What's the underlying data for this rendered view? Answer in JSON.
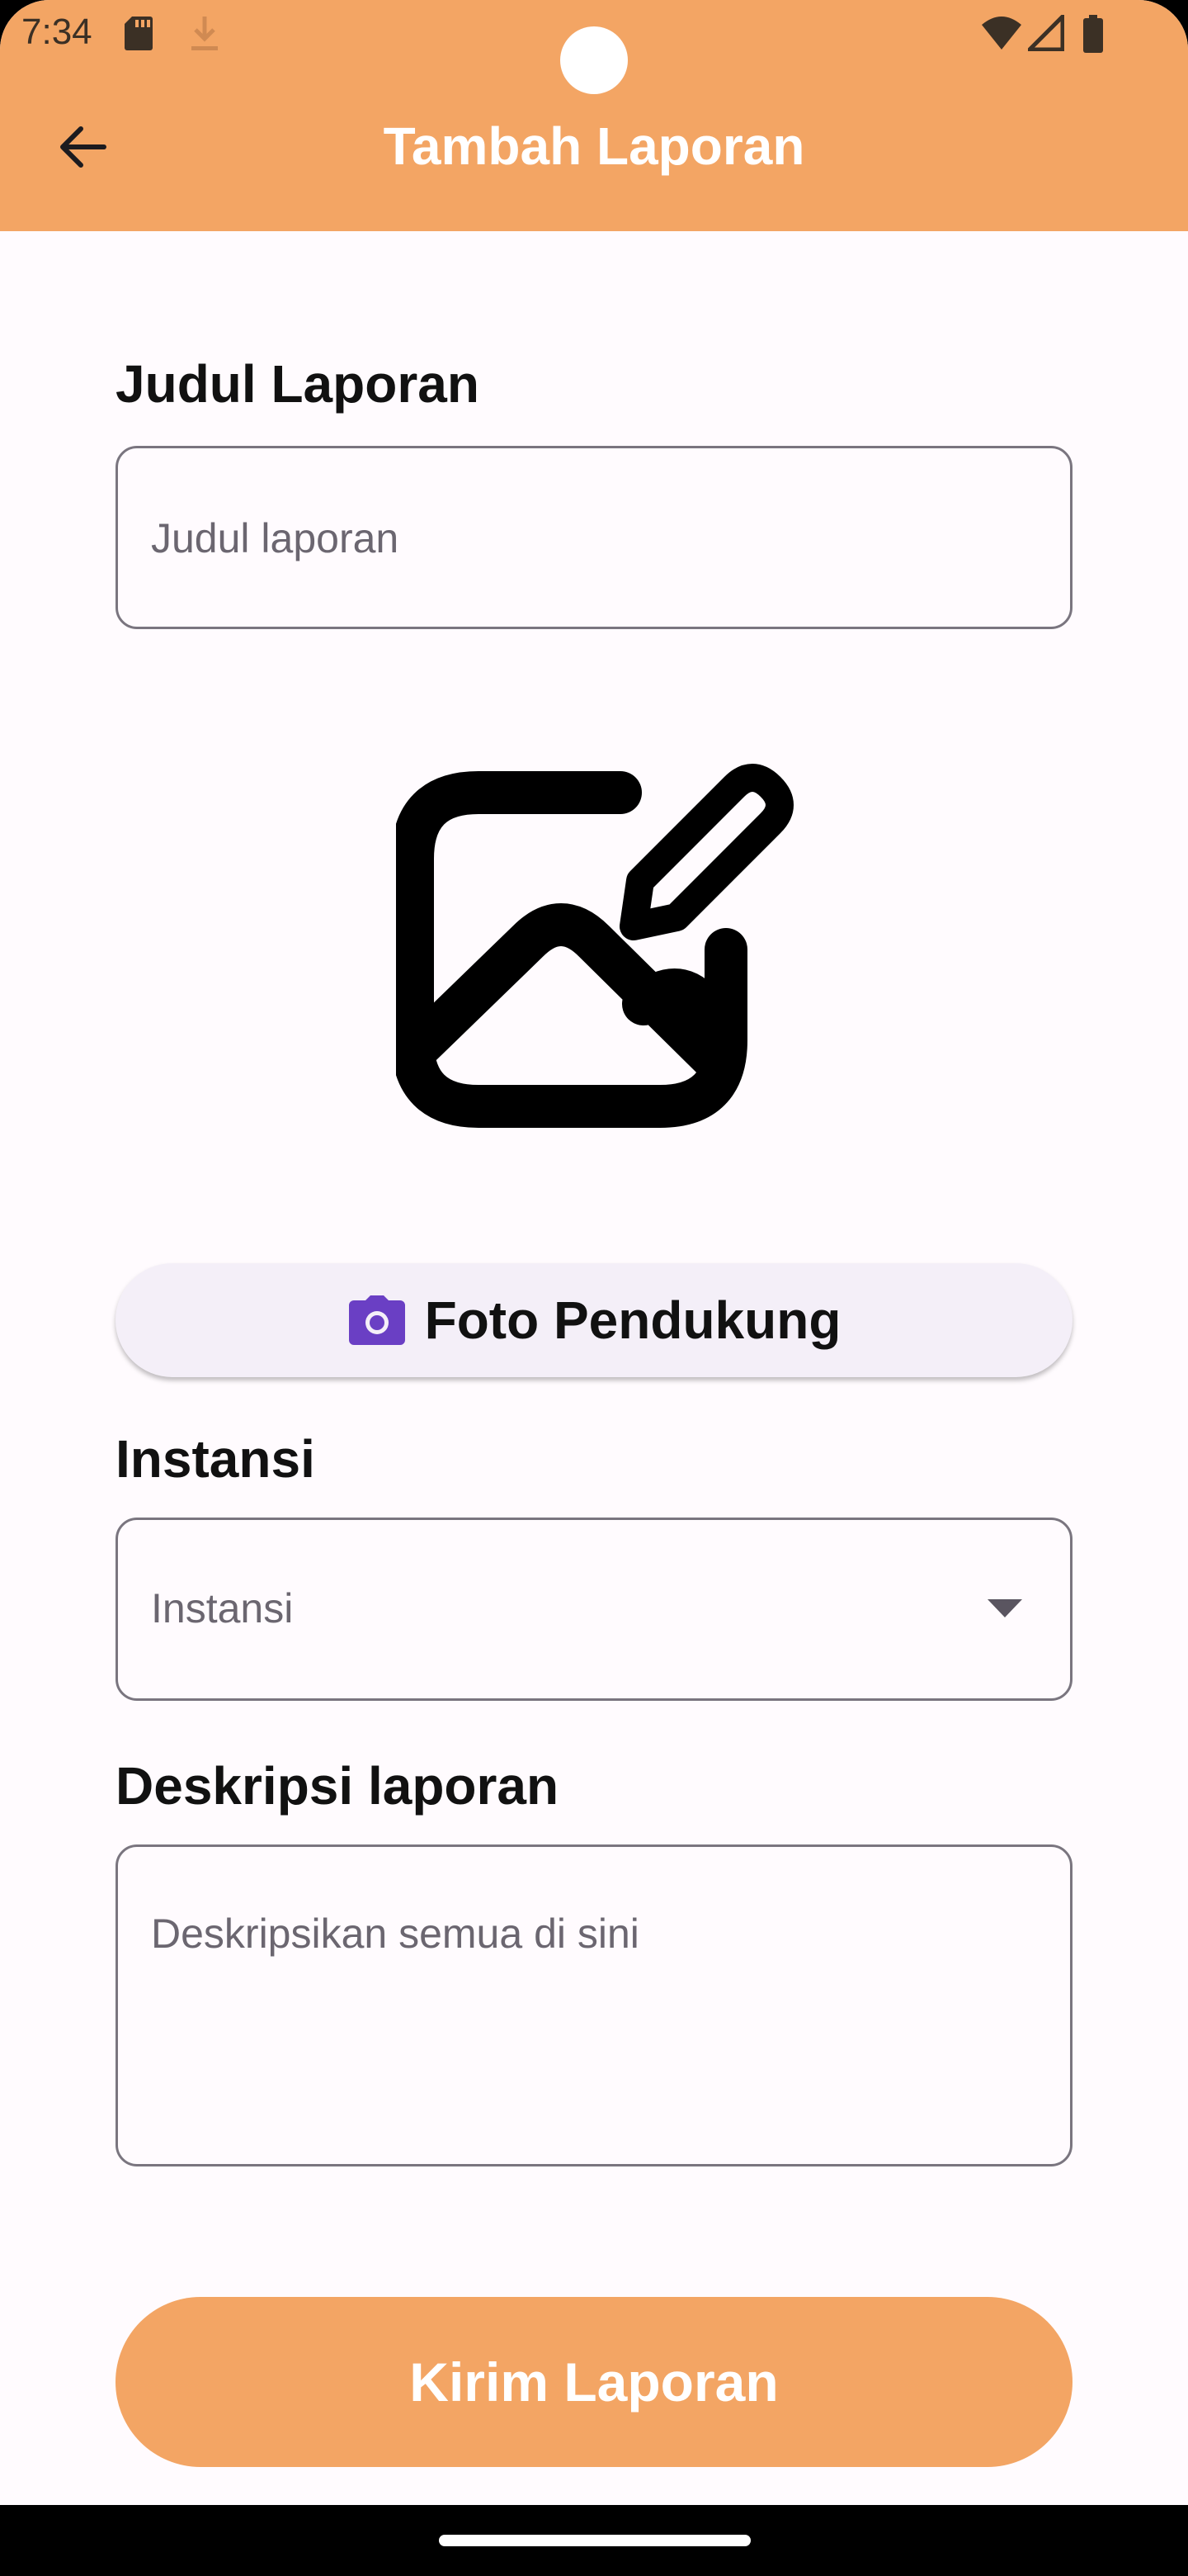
{
  "status_bar": {
    "time": "7:34"
  },
  "app_bar": {
    "title": "Tambah Laporan",
    "back_icon": "arrow-left-icon"
  },
  "form": {
    "title_label": "Judul Laporan",
    "title_placeholder": "Judul laporan",
    "photo_button_label": "Foto Pendukung",
    "instansi_label": "Instansi",
    "instansi_placeholder": "Instansi",
    "description_label": "Deskripsi laporan",
    "description_placeholder": "Deskripsikan semua di sini",
    "submit_label": "Kirim Laporan"
  },
  "colors": {
    "accent": "#f3a564",
    "camera_icon": "#6a3fc4",
    "background": "#fffbfe"
  }
}
